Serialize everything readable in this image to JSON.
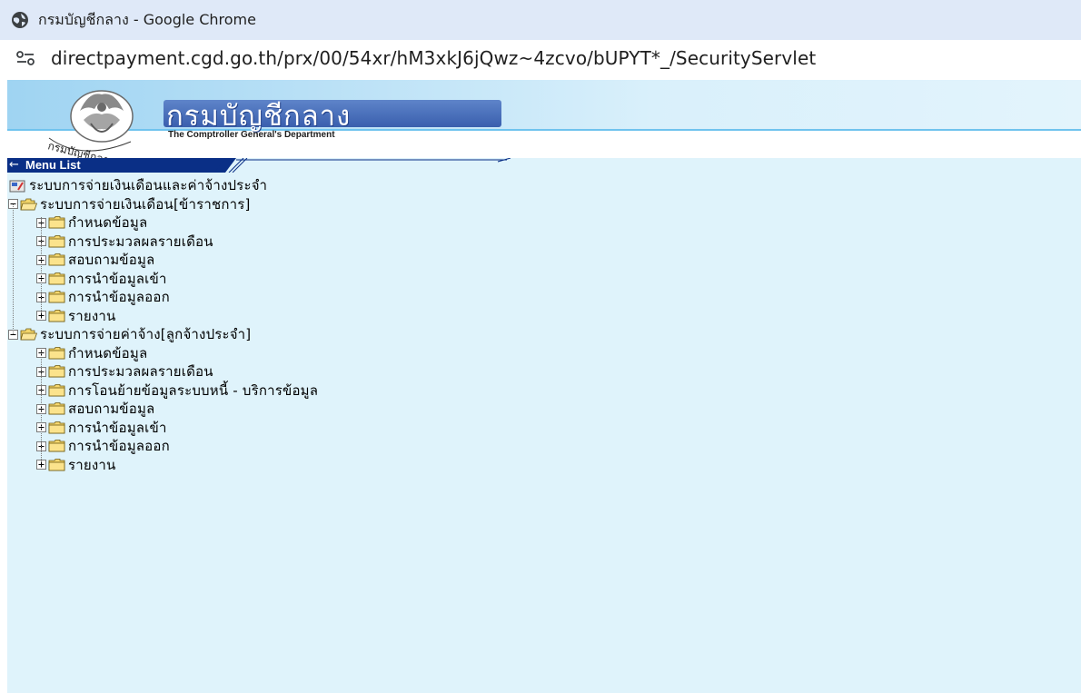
{
  "browser": {
    "window_title": "กรมบัญชีกลาง - Google Chrome",
    "url": "directpayment.cgd.go.th/prx/00/54xr/hM3xkJ6jQwz~4zcvo/bUPYT*_/SecurityServlet"
  },
  "header": {
    "dept_name_th": "กรมบัญชีกลาง",
    "dept_name_en": "The Comptroller General's Department",
    "logo_caption": "กรมบัญชีกลาง"
  },
  "menu": {
    "title": "Menu List",
    "root_label": "ระบบการจ่ายเงินเดือนและค่าจ้างประจำ",
    "groups": [
      {
        "label": "ระบบการจ่ายเงินเดือน[ข้าราชการ]",
        "items": [
          "กำหนดข้อมูล",
          "การประมวลผลรายเดือน",
          "สอบถามข้อมูล",
          "การนำข้อมูลเข้า",
          "การนำข้อมูลออก",
          "รายงาน"
        ]
      },
      {
        "label": "ระบบการจ่ายค่าจ้าง[ลูกจ้างประจำ]",
        "items": [
          "กำหนดข้อมูล",
          "การประมวลผลรายเดือน",
          "การโอนย้ายข้อมูลระบบหนี้ - บริการข้อมูล",
          "สอบถามข้อมูล",
          "การนำข้อมูลเข้า",
          "การนำข้อมูลออก",
          "รายงาน"
        ]
      }
    ]
  },
  "colors": {
    "content_bg": "#dff3fb",
    "menu_bar": "#0a2f86",
    "titlebar_bg": "#dfe9f8",
    "folder": "#f5d76e"
  }
}
